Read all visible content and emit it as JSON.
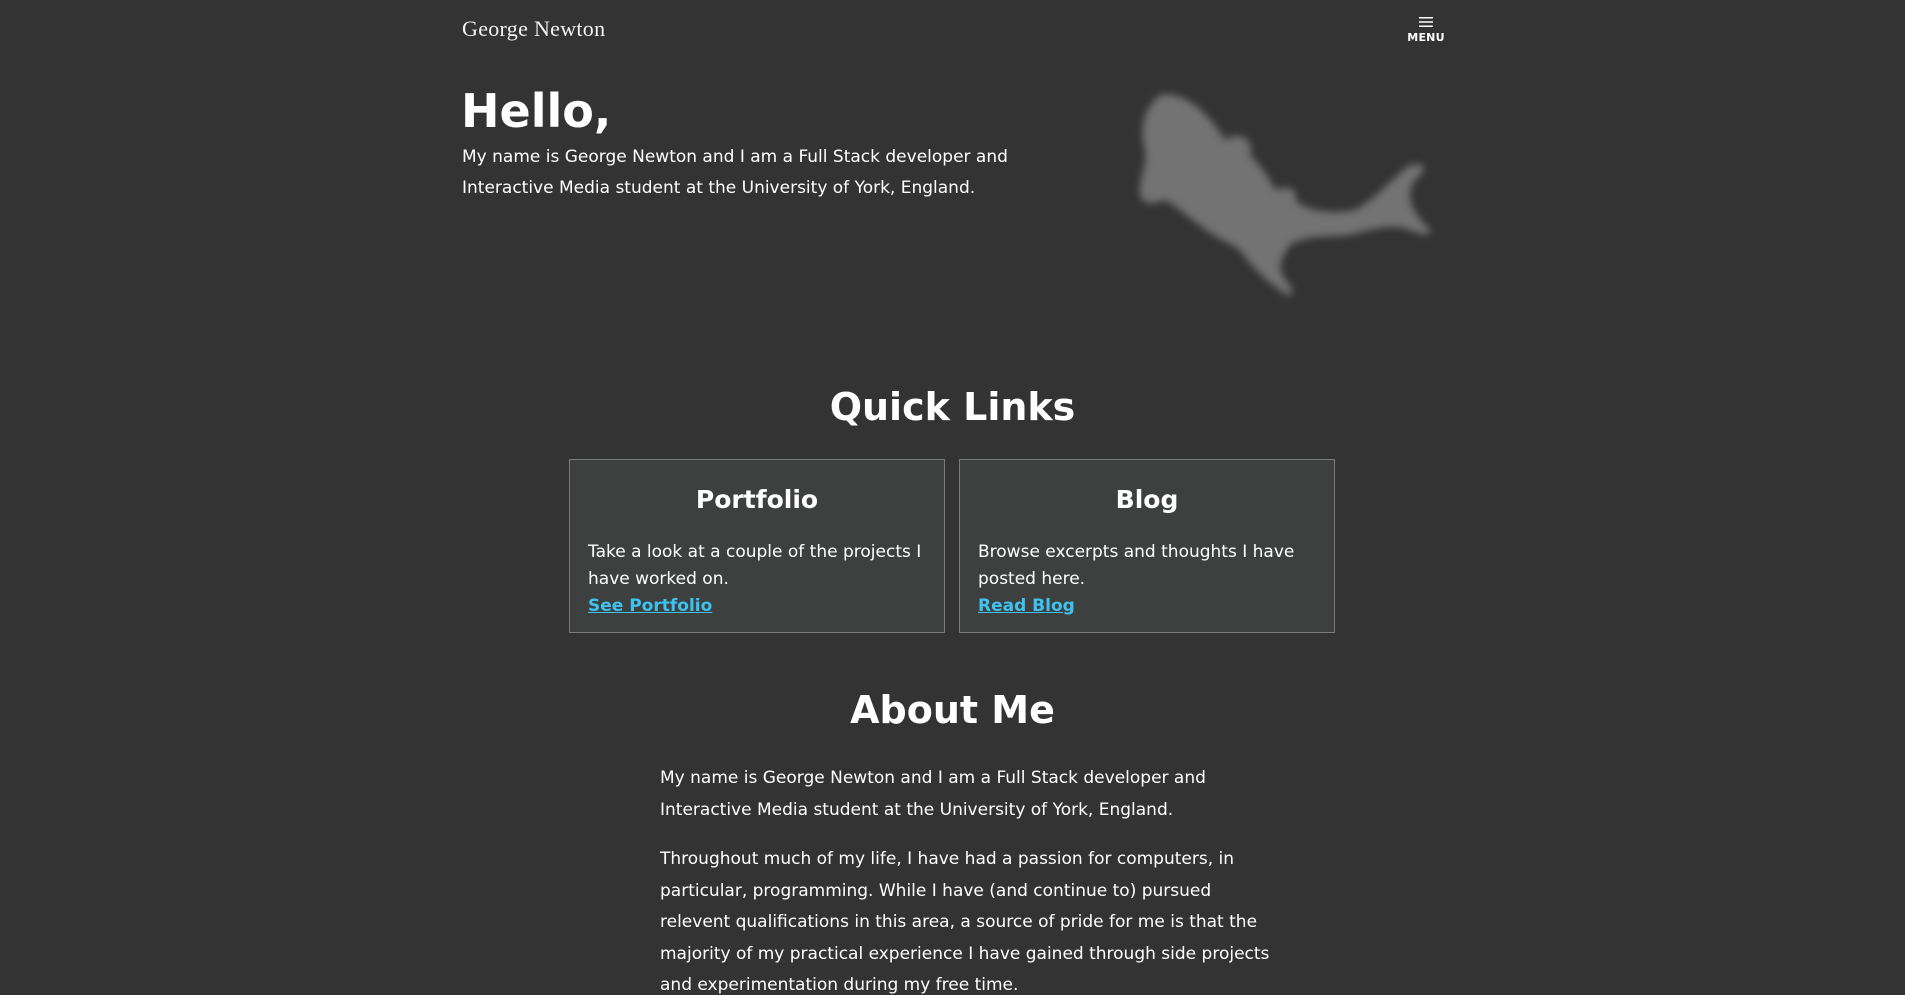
{
  "header": {
    "site_title": "George Newton",
    "menu_label": "MENU"
  },
  "hero": {
    "heading": "Hello,",
    "intro": "My name is George Newton and I am a Full Stack developer and Interactive Media student at the University of York, England."
  },
  "quick_links": {
    "heading": "Quick Links",
    "cards": [
      {
        "title": "Portfolio",
        "text": "Take a look at a couple of the projects I have worked on.",
        "link": "See Portfolio"
      },
      {
        "title": "Blog",
        "text": "Browse excerpts and thoughts I have posted here.",
        "link": "Read Blog"
      }
    ]
  },
  "about": {
    "heading": "About Me",
    "paragraphs": [
      "My name is George Newton and I am a Full Stack developer and Interactive Media student at the University of York, England.",
      "Throughout much of my life, I have had a passion for computers, in particular, programming. While I have (and continue to) pursued relevent qualifications in this area, a source of pride for me is that the majority of my practical experience I have gained through side projects and experimentation during my free time."
    ]
  },
  "colors": {
    "background": "#333333",
    "card_background": "#3d403f",
    "card_border": "#7a7a7a",
    "link": "#3ec3f0",
    "text": "#ffffff"
  },
  "icons": {
    "menu": "hamburger-icon",
    "hero_decoration": "fish-icon"
  }
}
